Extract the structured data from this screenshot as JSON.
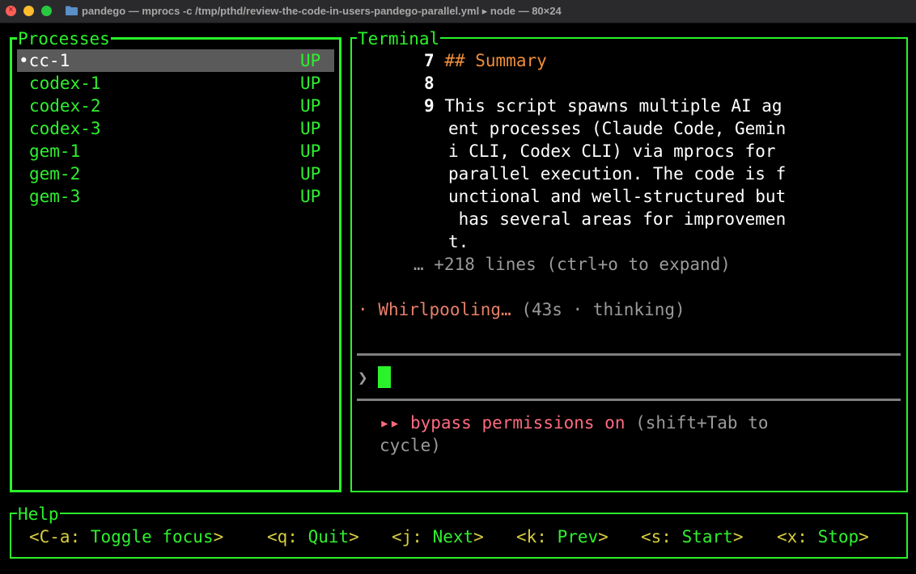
{
  "window": {
    "title": "pandego — mprocs -c /tmp/pthd/review-the-code-in-users-pandego-parallel.yml ▸ node — 80×24"
  },
  "processes_panel": {
    "title": "Processes",
    "items": [
      {
        "name": "•cc-1",
        "status": "UP"
      },
      {
        "name": "codex-1",
        "status": "UP"
      },
      {
        "name": "codex-2",
        "status": "UP"
      },
      {
        "name": "codex-3",
        "status": "UP"
      },
      {
        "name": "gem-1",
        "status": "UP"
      },
      {
        "name": "gem-2",
        "status": "UP"
      },
      {
        "name": "gem-3",
        "status": "UP"
      }
    ]
  },
  "terminal_panel": {
    "title": "Terminal",
    "lines": [
      {
        "num": "7",
        "text": "## Summary"
      },
      {
        "num": "8",
        "text": ""
      },
      {
        "num": "9",
        "text": "This script spawns multiple AI ag"
      }
    ],
    "wrapped": [
      "ent processes (Claude Code, Gemin",
      "i CLI, Codex CLI) via mprocs for",
      "parallel execution. The code is f",
      "unctional and well-structured but",
      " has several areas for improvemen",
      "t."
    ],
    "more_lines": "… +218 lines (ctrl+o to expand)",
    "status_dot": "·",
    "status_word": "Whirlpooling…",
    "status_detail": "(43s · thinking)",
    "prompt_symbol": "❯",
    "mode_arrows": "▸▸",
    "mode_label": "bypass permissions on",
    "mode_hint": "(shift+Tab to",
    "mode_hint2": "cycle)"
  },
  "help_panel": {
    "title": "Help",
    "items": [
      {
        "key": "<C-a:",
        "label": "Toggle focus",
        "close": ">"
      },
      {
        "key": "<q:",
        "label": "Quit",
        "close": ">"
      },
      {
        "key": "<j:",
        "label": "Next",
        "close": ">"
      },
      {
        "key": "<k:",
        "label": "Prev",
        "close": ">"
      },
      {
        "key": "<s:",
        "label": "Start",
        "close": ">"
      },
      {
        "key": "<x:",
        "label": "Stop",
        "close": ">"
      }
    ]
  },
  "colors": {
    "border": "#2bf22b",
    "selection": "#5a5a5a",
    "heading": "#ef8e3a",
    "thinking": "#e77f69",
    "warning": "#ff6b7f",
    "help_key": "#d6cc3c"
  }
}
